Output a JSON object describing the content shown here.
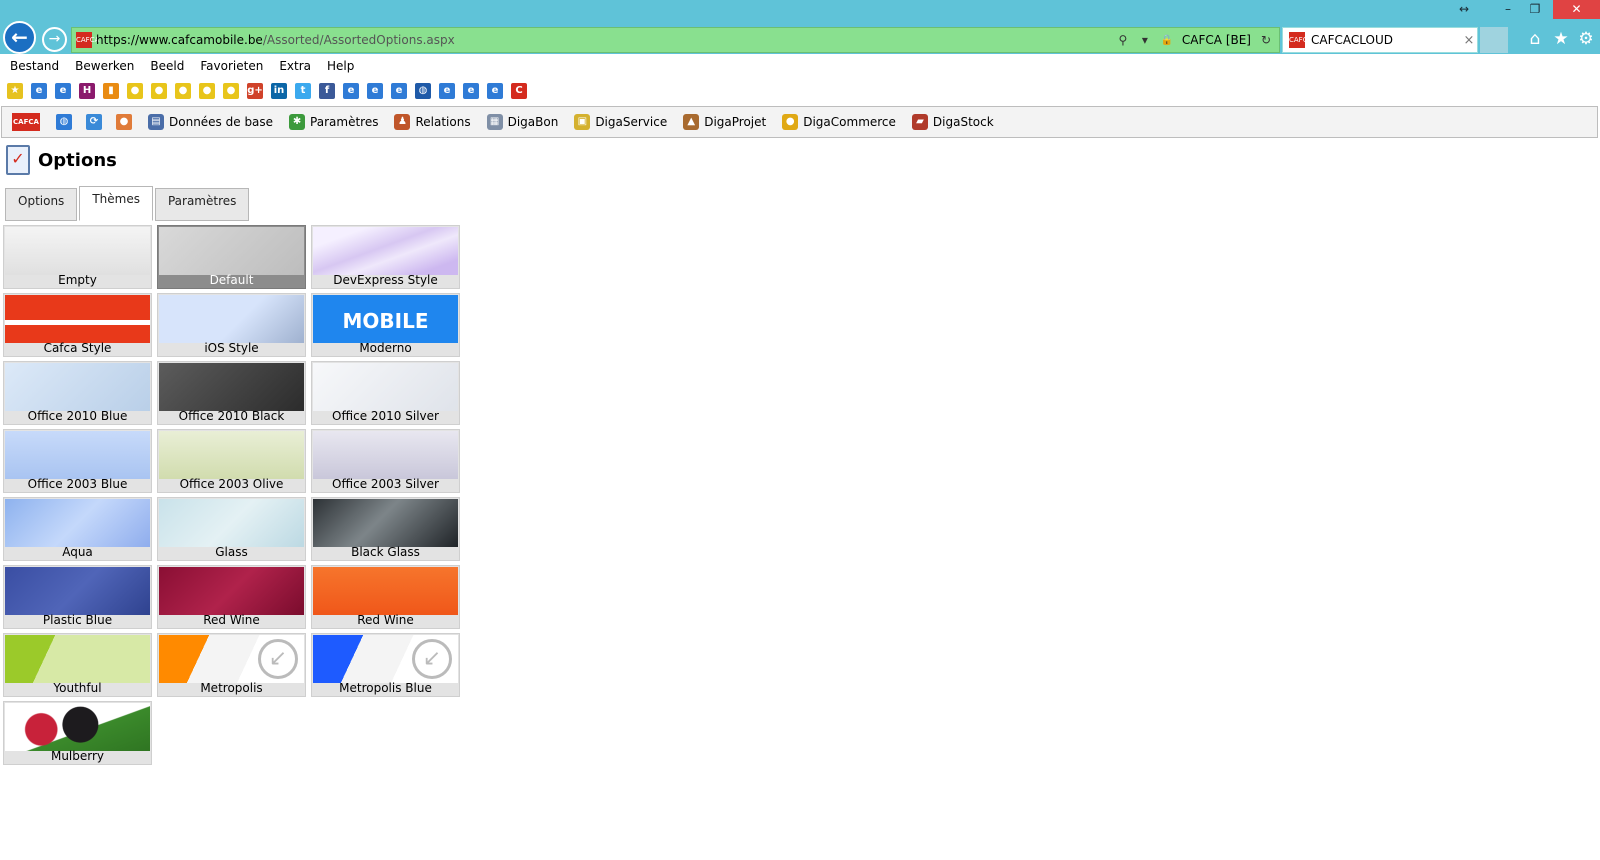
{
  "window": {
    "resize_glyph": "↔",
    "minimize_glyph": "–",
    "maximize_glyph": "❐",
    "close_glyph": "✕"
  },
  "address_bar": {
    "scheme": "https://",
    "domain": "www.cafcamobile.be",
    "path": "/Assorted/AssortedOptions.aspx",
    "site_identity": "CAFCA [BE]",
    "search_glyph": "⚲",
    "dropdown_glyph": "▾",
    "lock_glyph": "🔒",
    "refresh_glyph": "↻"
  },
  "browser_tab": {
    "title": "CAFCACLOUD",
    "close_glyph": "×"
  },
  "menu": {
    "items": [
      "Bestand",
      "Bewerken",
      "Beeld",
      "Favorieten",
      "Extra",
      "Help"
    ]
  },
  "favorites_bar": {
    "icons": [
      {
        "name": "add-favorite-icon",
        "glyph": "★",
        "color": "#e6c21f"
      },
      {
        "name": "ie-icon",
        "glyph": "e",
        "color": "#2f7bd6"
      },
      {
        "name": "ie-icon",
        "glyph": "e",
        "color": "#2f7bd6"
      },
      {
        "name": "h-logo-icon",
        "glyph": "H",
        "color": "#8b1a6c"
      },
      {
        "name": "flag-icon",
        "glyph": "▮",
        "color": "#e98b12"
      },
      {
        "name": "speed-icon",
        "glyph": "●",
        "color": "#e8c51b"
      },
      {
        "name": "speed-icon",
        "glyph": "●",
        "color": "#e8c51b"
      },
      {
        "name": "speed-icon",
        "glyph": "●",
        "color": "#e8c51b"
      },
      {
        "name": "speed-icon",
        "glyph": "●",
        "color": "#e8c51b"
      },
      {
        "name": "speed-icon",
        "glyph": "●",
        "color": "#e8c51b"
      },
      {
        "name": "google-plus-icon",
        "glyph": "g+",
        "color": "#d0422a"
      },
      {
        "name": "linkedin-icon",
        "glyph": "in",
        "color": "#0b66a7"
      },
      {
        "name": "twitter-icon",
        "glyph": "t",
        "color": "#3ba9ee"
      },
      {
        "name": "facebook-icon",
        "glyph": "f",
        "color": "#3b5998"
      },
      {
        "name": "ie-icon",
        "glyph": "e",
        "color": "#2f7bd6"
      },
      {
        "name": "ie-icon",
        "glyph": "e",
        "color": "#2f7bd6"
      },
      {
        "name": "ie-icon",
        "glyph": "e",
        "color": "#2f7bd6"
      },
      {
        "name": "globe-icon",
        "glyph": "◍",
        "color": "#1f5aa8"
      },
      {
        "name": "ie-icon",
        "glyph": "e",
        "color": "#2f7bd6"
      },
      {
        "name": "ie-icon",
        "glyph": "e",
        "color": "#2f7bd6"
      },
      {
        "name": "ie-icon",
        "glyph": "e",
        "color": "#2f7bd6"
      },
      {
        "name": "cafca-icon",
        "glyph": "C",
        "color": "#d42b1e"
      }
    ]
  },
  "app_toolbar": {
    "logo_text": "CAFCA",
    "quick_icons": [
      {
        "name": "globe-icon",
        "glyph": "◍",
        "color": "#2f7bd6"
      },
      {
        "name": "sync-icon",
        "glyph": "⟳",
        "color": "#3a8ad8"
      },
      {
        "name": "user-icon",
        "glyph": "●",
        "color": "#e07b39"
      }
    ],
    "items": [
      {
        "name": "toolbar-item-donnees-de-base",
        "label": "Données de base",
        "glyph": "▤",
        "color": "#4a6da8"
      },
      {
        "name": "toolbar-item-parametres",
        "label": "Paramètres",
        "glyph": "✱",
        "color": "#3c9a3c"
      },
      {
        "name": "toolbar-item-relations",
        "label": "Relations",
        "glyph": "♟",
        "color": "#c0562a"
      },
      {
        "name": "toolbar-item-digabon",
        "label": "DigaBon",
        "glyph": "▦",
        "color": "#7f8fa6"
      },
      {
        "name": "toolbar-item-digaservice",
        "label": "DigaService",
        "glyph": "▣",
        "color": "#d4b12f"
      },
      {
        "name": "toolbar-item-digaprojet",
        "label": "DigaProjet",
        "glyph": "▲",
        "color": "#a86a2f"
      },
      {
        "name": "toolbar-item-digacommerce",
        "label": "DigaCommerce",
        "glyph": "●",
        "color": "#e0a915"
      },
      {
        "name": "toolbar-item-digastock",
        "label": "DigaStock",
        "glyph": "▰",
        "color": "#b03a2a"
      }
    ]
  },
  "page": {
    "title": "Options",
    "tabs": [
      {
        "label": "Options",
        "active": false
      },
      {
        "label": "Thèmes",
        "active": true
      },
      {
        "label": "Paramètres",
        "active": false
      }
    ]
  },
  "themes": [
    {
      "label": "Empty",
      "selected": false,
      "bg": "linear-gradient(#f4f4f4,#e0e0e0)"
    },
    {
      "label": "Default",
      "selected": true,
      "bg": "linear-gradient(135deg,#d9d9d9,#bdbdbd)"
    },
    {
      "label": "DevExpress Style",
      "selected": false,
      "bg": "linear-gradient(160deg,#f5f0ff 20%,#d7c7f2 45%,#efe8fb 60%,#cdb8f0 85%)"
    },
    {
      "label": "Cafca Style",
      "selected": false,
      "bg": "linear-gradient(#e8391a 0%,#e8391a 52%,#ffffff 52%,#ffffff 62%,#e8391a 62%)"
    },
    {
      "label": "iOS Style",
      "selected": false,
      "bg": "linear-gradient(135deg,#d7e4fb 55%,#9fb1cf 100%)"
    },
    {
      "label": "Moderno",
      "selected": false,
      "bg": "#1f86ee",
      "overlay": "MOBILE"
    },
    {
      "label": "Office 2010 Blue",
      "selected": false,
      "bg": "linear-gradient(135deg,#dce9f8,#b9cfe8)"
    },
    {
      "label": "Office 2010 Black",
      "selected": false,
      "bg": "linear-gradient(135deg,#5c5c5c,#2c2c2c)"
    },
    {
      "label": "Office 2010 Silver",
      "selected": false,
      "bg": "linear-gradient(135deg,#f7f8fa,#dfe3ea)"
    },
    {
      "label": "Office 2003 Blue",
      "selected": false,
      "bg": "linear-gradient(#c7dafa,#a9c4f1)"
    },
    {
      "label": "Office 2003 Olive",
      "selected": false,
      "bg": "linear-gradient(#e9efd6,#d1dcae)"
    },
    {
      "label": "Office 2003 Silver",
      "selected": false,
      "bg": "linear-gradient(#e8e7f0,#c9c7da)"
    },
    {
      "label": "Aqua",
      "selected": false,
      "bg": "linear-gradient(135deg,#8eb2ee,#c4d8fb 50%,#8faded)"
    },
    {
      "label": "Glass",
      "selected": false,
      "bg": "linear-gradient(135deg,#c9e2ea,#e4f1f4 50%,#bcd9e3)"
    },
    {
      "label": "Black Glass",
      "selected": false,
      "bg": "linear-gradient(135deg,#2d3236,#7d8589 45%,#202428)"
    },
    {
      "label": "Plastic Blue",
      "selected": false,
      "bg": "linear-gradient(135deg,#3a4ea3,#5065b8 50%,#2f428f)"
    },
    {
      "label": "Red Wine",
      "selected": false,
      "bg": "linear-gradient(135deg,#8a0f34,#b0224b 50%,#7a0c2d)"
    },
    {
      "label": "Red Wine",
      "selected": false,
      "bg": "linear-gradient(#f6752c,#f0571a)"
    },
    {
      "label": "Youthful",
      "selected": false,
      "bg": "linear-gradient(115deg,#9bca2a 0%,#9bca2a 30%,#d7e9a6 30%,#d7e9a6 100%)"
    },
    {
      "label": "Metropolis",
      "selected": false,
      "bg": "linear-gradient(115deg,#ff8a00 0%,#ff8a00 30%,#f4f4f4 30%,#f4f4f4 60%,#ffffff 60%)",
      "corner": "↙"
    },
    {
      "label": "Metropolis Blue",
      "selected": false,
      "bg": "linear-gradient(115deg,#1e5bff 0%,#1e5bff 30%,#f4f4f4 30%,#f4f4f4 60%,#ffffff 60%)",
      "corner": "↙"
    },
    {
      "label": "Mulberry",
      "selected": false,
      "bg": "radial-gradient(circle at 25% 55%,#c8223a 0,#c8223a 14%,transparent 15%),radial-gradient(circle at 52% 45%,#1d1b1e 0,#1d1b1e 22%,transparent 23%),linear-gradient(160deg,#ffffff 55%,#3b8a2b 56%,#2f7522)"
    }
  ]
}
